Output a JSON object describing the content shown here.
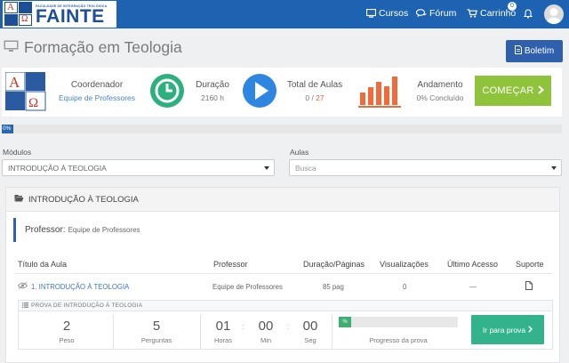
{
  "header": {
    "logo_small": "FACULDADE DE INTEGRAÇÃO TEOLÓGICA",
    "logo_big": "FAINTE",
    "logo_letters": [
      "A",
      "Ω"
    ],
    "nav": [
      {
        "label": "Cursos",
        "icon": "monitor-icon"
      },
      {
        "label": "Fórum",
        "icon": "chat-bubbles-icon"
      },
      {
        "label": "Carrinho",
        "icon": "cart-icon"
      }
    ],
    "cart_count": "0",
    "bell_icon": "bell-icon",
    "brand_color": "#1e62b2"
  },
  "page": {
    "title": "Formação em Teologia",
    "boletim_label": "Boletim"
  },
  "info": {
    "coordenador_label": "Coordenador",
    "coordenador_value": "Equipe de Professores",
    "duracao_label": "Duração",
    "duracao_value": "2160 h",
    "total_aulas_label": "Total de Aulas",
    "aulas_done": "0",
    "aulas_sep": " / ",
    "aulas_total": "27",
    "andamento_label": "Andamento",
    "andamento_value": "0% Concluído",
    "comecar_label": "COMEÇAR"
  },
  "progress": {
    "label": "0%",
    "fraction": 0.0
  },
  "filters": {
    "modulos_label": "Módulos",
    "modulos_value": "INTRODUÇÃO À TEOLOGIA",
    "aulas_label": "Aulas",
    "aulas_placeholder": "Busca"
  },
  "module": {
    "title": "INTRODUÇÃO À TEOLOGIA",
    "professor_label": "Professor:",
    "professor_value": "Equipe de Professores",
    "columns": [
      "Título da Aula",
      "Professor",
      "Duração/Páginas",
      "Visualizações",
      "Último Acesso",
      "Suporte"
    ],
    "rows": [
      {
        "title": "1. INTRODUÇÃO À TEOLOGIA",
        "professor": "Equipe de Professores",
        "duracao": "85 pag",
        "views": "0",
        "ultimo": "—"
      }
    ],
    "prova": {
      "title": "PROVA DE INTRODUÇÃO À TEOLOGIA",
      "peso_value": "2",
      "peso_label": "Peso",
      "perguntas_value": "5",
      "perguntas_label": "Perguntas",
      "horas_value": "01",
      "horas_label": "Horas",
      "min_value": "00",
      "min_label": "Min",
      "seg_value": "00",
      "seg_label": "Seg",
      "bar_label": "%",
      "progresso_label": "Progresso da prova",
      "button_label": "Ir para prova"
    }
  }
}
